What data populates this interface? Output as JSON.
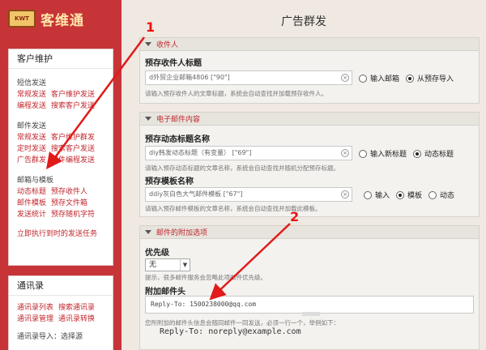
{
  "app": {
    "logo_badge": "KWT",
    "logo_text": "客维通"
  },
  "page_title": "广告群发",
  "sidebar": {
    "panel1": {
      "title": "客户维护",
      "groups": [
        {
          "title": "短信发送",
          "rows": [
            [
              "常规发送",
              "客户维护发送"
            ],
            [
              "编程发送",
              "搜索客户发送"
            ]
          ]
        },
        {
          "title": "邮件发送",
          "rows": [
            [
              "常规发送",
              "客户维护群发"
            ],
            [
              "定时发送",
              "搜索客户发送"
            ],
            [
              "广告群发",
              "邮件编程发送"
            ]
          ]
        },
        {
          "title": "邮箱与模板",
          "rows": [
            [
              "动态标题",
              "预存收件人"
            ],
            [
              "邮件模板",
              "预存文件箱"
            ],
            [
              "发送统计",
              "预存随机字符"
            ]
          ]
        }
      ],
      "footer_link": "立即执行到时的发送任务"
    },
    "panel2": {
      "title": "通讯录",
      "rows": [
        [
          "通讯录列表",
          "搜索通讯录"
        ],
        [
          "通讯录管理",
          "通讯录转换"
        ]
      ],
      "trailing": "通讯录导入：选择源"
    }
  },
  "sections": {
    "recipients": {
      "header": "收件人",
      "label": "预存收件人标题",
      "input_value": "d外贸企业邮箱4806 [\"90\"]",
      "hint": "请输入预存收件人的文章标题，系统会自动查找并加载预存收件人。",
      "radio_a": "输入邮箱",
      "radio_b": "从预存导入"
    },
    "content": {
      "header": "电子邮件内容",
      "subject_label": "预存动态标题名称",
      "subject_value": "diy韩发动态标题（有变量） [\"69\"]",
      "subject_hint": "请输入预存动态标题的文章名称，系统会自动查找并随机分配预存标题。",
      "subject_radio_a": "输入新标题",
      "subject_radio_b": "动态标题",
      "template_label": "预存模板名称",
      "template_value": "ddiy灰白色大气邮件模板 [\"67\"]",
      "template_hint": "请输入预存邮件模板的文章名称，系统会自动查找并加载此模板。",
      "template_radio_a": "输入",
      "template_radio_b": "模板",
      "template_radio_c": "动态"
    },
    "extras": {
      "header": "邮件的附加选项",
      "priority_label": "优先级",
      "priority_value": "无",
      "priority_hint": "提示，很多邮件服务会忽略此项邮件优先级。",
      "headers_label": "附加邮件头",
      "headers_value": "Reply-To: 1500238000@qq.com",
      "headers_hint": "您所附加的邮件头信息会随同邮件一同发送，必须一行一个，举例如下：",
      "headers_example": "Reply-To: noreply@example.com"
    }
  },
  "annotations": {
    "num1": "1",
    "num2": "2",
    "color": "#e11a1a"
  }
}
